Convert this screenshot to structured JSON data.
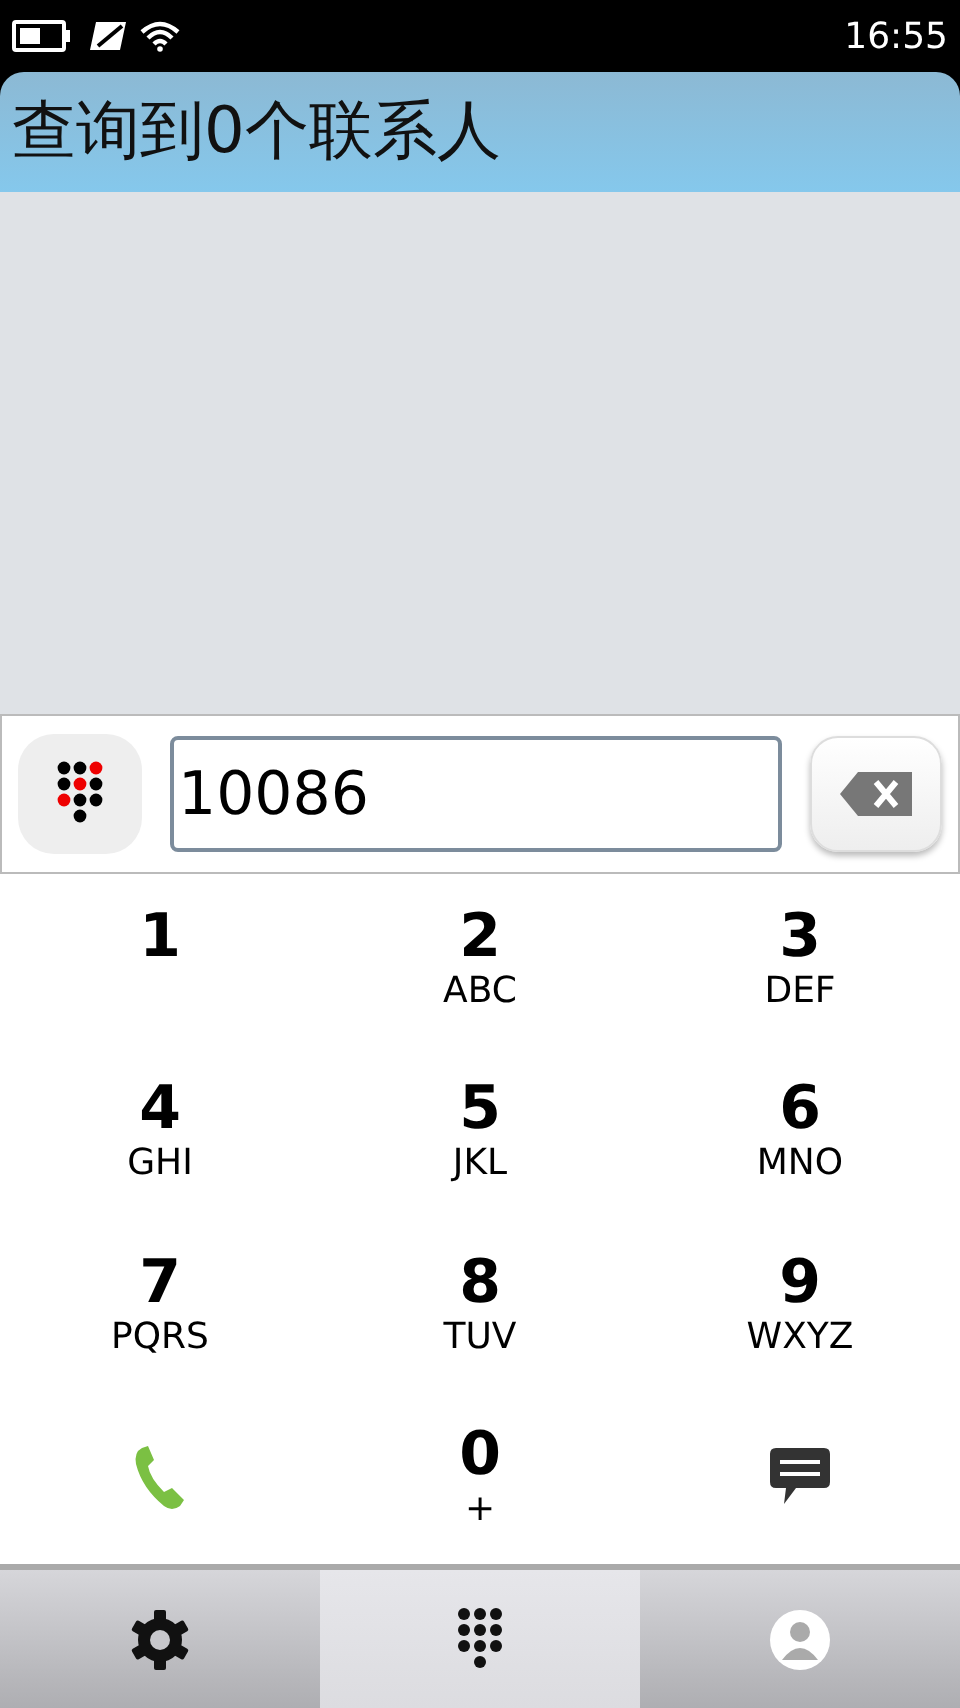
{
  "status_bar": {
    "time": "16:55"
  },
  "header": {
    "title": "查询到0个联系人"
  },
  "dial_field": {
    "value": "10086"
  },
  "keys": [
    {
      "kind": "digit",
      "digit": "1"
    },
    {
      "kind": "digit",
      "digit": "2",
      "letters": "ABC"
    },
    {
      "kind": "digit",
      "digit": "3",
      "letters": "DEF"
    },
    {
      "kind": "digit",
      "digit": "4",
      "letters": "GHI"
    },
    {
      "kind": "digit",
      "digit": "5",
      "letters": "JKL"
    },
    {
      "kind": "digit",
      "digit": "6",
      "letters": "MNO"
    },
    {
      "kind": "digit",
      "digit": "7",
      "letters": "PQRS"
    },
    {
      "kind": "digit",
      "digit": "8",
      "letters": "TUV"
    },
    {
      "kind": "digit",
      "digit": "9",
      "letters": "WXYZ"
    },
    {
      "kind": "call"
    },
    {
      "kind": "digit",
      "digit": "0",
      "letters": "+"
    },
    {
      "kind": "message"
    }
  ],
  "tabs": [
    {
      "kind": "settings",
      "selected": false
    },
    {
      "kind": "dialpad",
      "selected": true
    },
    {
      "kind": "contacts",
      "selected": false
    }
  ]
}
